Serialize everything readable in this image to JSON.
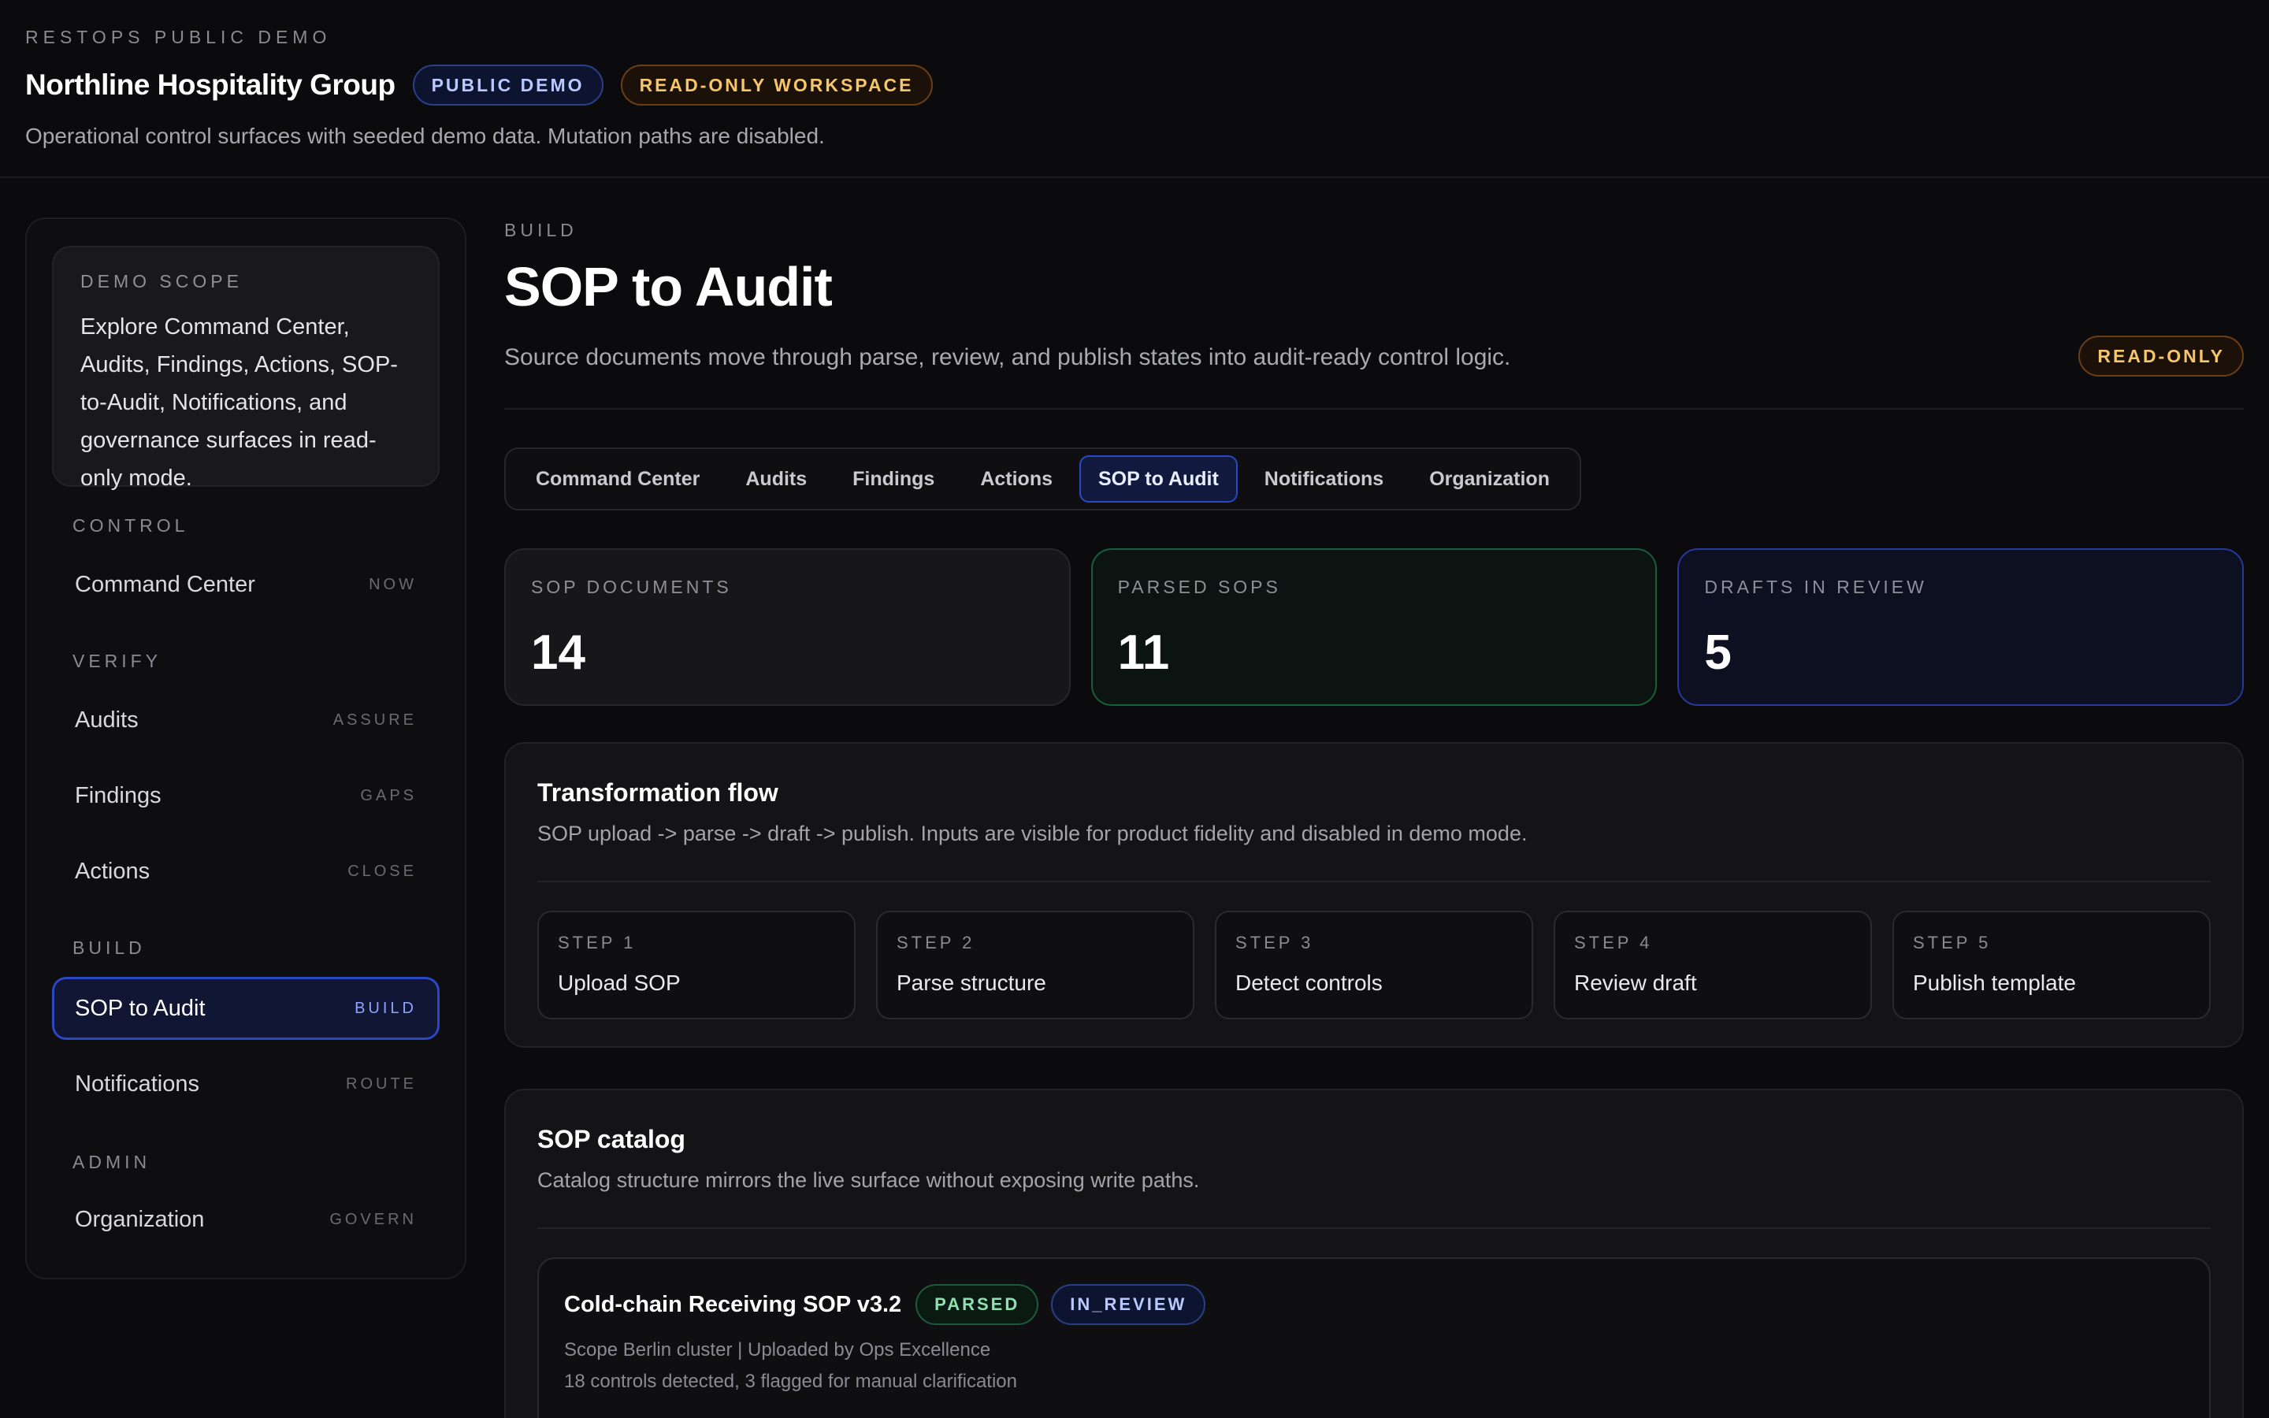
{
  "header": {
    "eyebrow": "RESTOPS PUBLIC DEMO",
    "org_name": "Northline Hospitality Group",
    "badge_demo": "PUBLIC DEMO",
    "badge_readonly": "READ-ONLY WORKSPACE",
    "subtitle": "Operational control surfaces with seeded demo data. Mutation paths are disabled."
  },
  "sidebar": {
    "scope_title": "DEMO SCOPE",
    "scope_text": "Explore Command Center, Audits, Findings, Actions, SOP-to-Audit, Notifications, and governance surfaces in read-only mode.",
    "sections": {
      "control": "CONTROL",
      "verify": "VERIFY",
      "build": "BUILD",
      "admin": "ADMIN"
    },
    "items": {
      "command_center": {
        "label": "Command Center",
        "tag": "NOW"
      },
      "audits": {
        "label": "Audits",
        "tag": "ASSURE"
      },
      "findings": {
        "label": "Findings",
        "tag": "GAPS"
      },
      "actions": {
        "label": "Actions",
        "tag": "CLOSE"
      },
      "sop_to_audit": {
        "label": "SOP to Audit",
        "tag": "BUILD"
      },
      "notifications": {
        "label": "Notifications",
        "tag": "ROUTE"
      },
      "organization": {
        "label": "Organization",
        "tag": "GOVERN"
      }
    }
  },
  "page": {
    "eyebrow": "BUILD",
    "title": "SOP to Audit",
    "subtitle": "Source documents move through parse, review, and publish states into audit-ready control logic.",
    "readonly_badge": "READ-ONLY"
  },
  "tabs": [
    "Command Center",
    "Audits",
    "Findings",
    "Actions",
    "SOP to Audit",
    "Notifications",
    "Organization"
  ],
  "stats": {
    "sop_documents": {
      "label": "SOP DOCUMENTS",
      "value": "14"
    },
    "parsed_sops": {
      "label": "PARSED SOPS",
      "value": "11"
    },
    "drafts_in_review": {
      "label": "DRAFTS IN REVIEW",
      "value": "5"
    }
  },
  "flow": {
    "title": "Transformation flow",
    "subtitle": "SOP upload -> parse -> draft -> publish. Inputs are visible for product fidelity and disabled in demo mode.",
    "steps": [
      {
        "num": "STEP 1",
        "name": "Upload SOP"
      },
      {
        "num": "STEP 2",
        "name": "Parse structure"
      },
      {
        "num": "STEP 3",
        "name": "Detect controls"
      },
      {
        "num": "STEP 4",
        "name": "Review draft"
      },
      {
        "num": "STEP 5",
        "name": "Publish template"
      }
    ]
  },
  "catalog": {
    "title": "SOP catalog",
    "subtitle": "Catalog structure mirrors the live surface without exposing write paths.",
    "items": [
      {
        "title": "Cold-chain Receiving SOP v3.2",
        "status_parsed": "PARSED",
        "status_review": "IN_REVIEW",
        "meta_line1": "Scope Berlin cluster | Uploaded by Ops Excellence",
        "meta_line2": "18 controls detected, 3 flagged for manual clarification"
      }
    ]
  },
  "colors": {
    "background": "#0b0b0d",
    "accent_blue": "#2c47c2",
    "accent_amber": "#f6c66a",
    "accent_green": "#8fe0b2"
  }
}
